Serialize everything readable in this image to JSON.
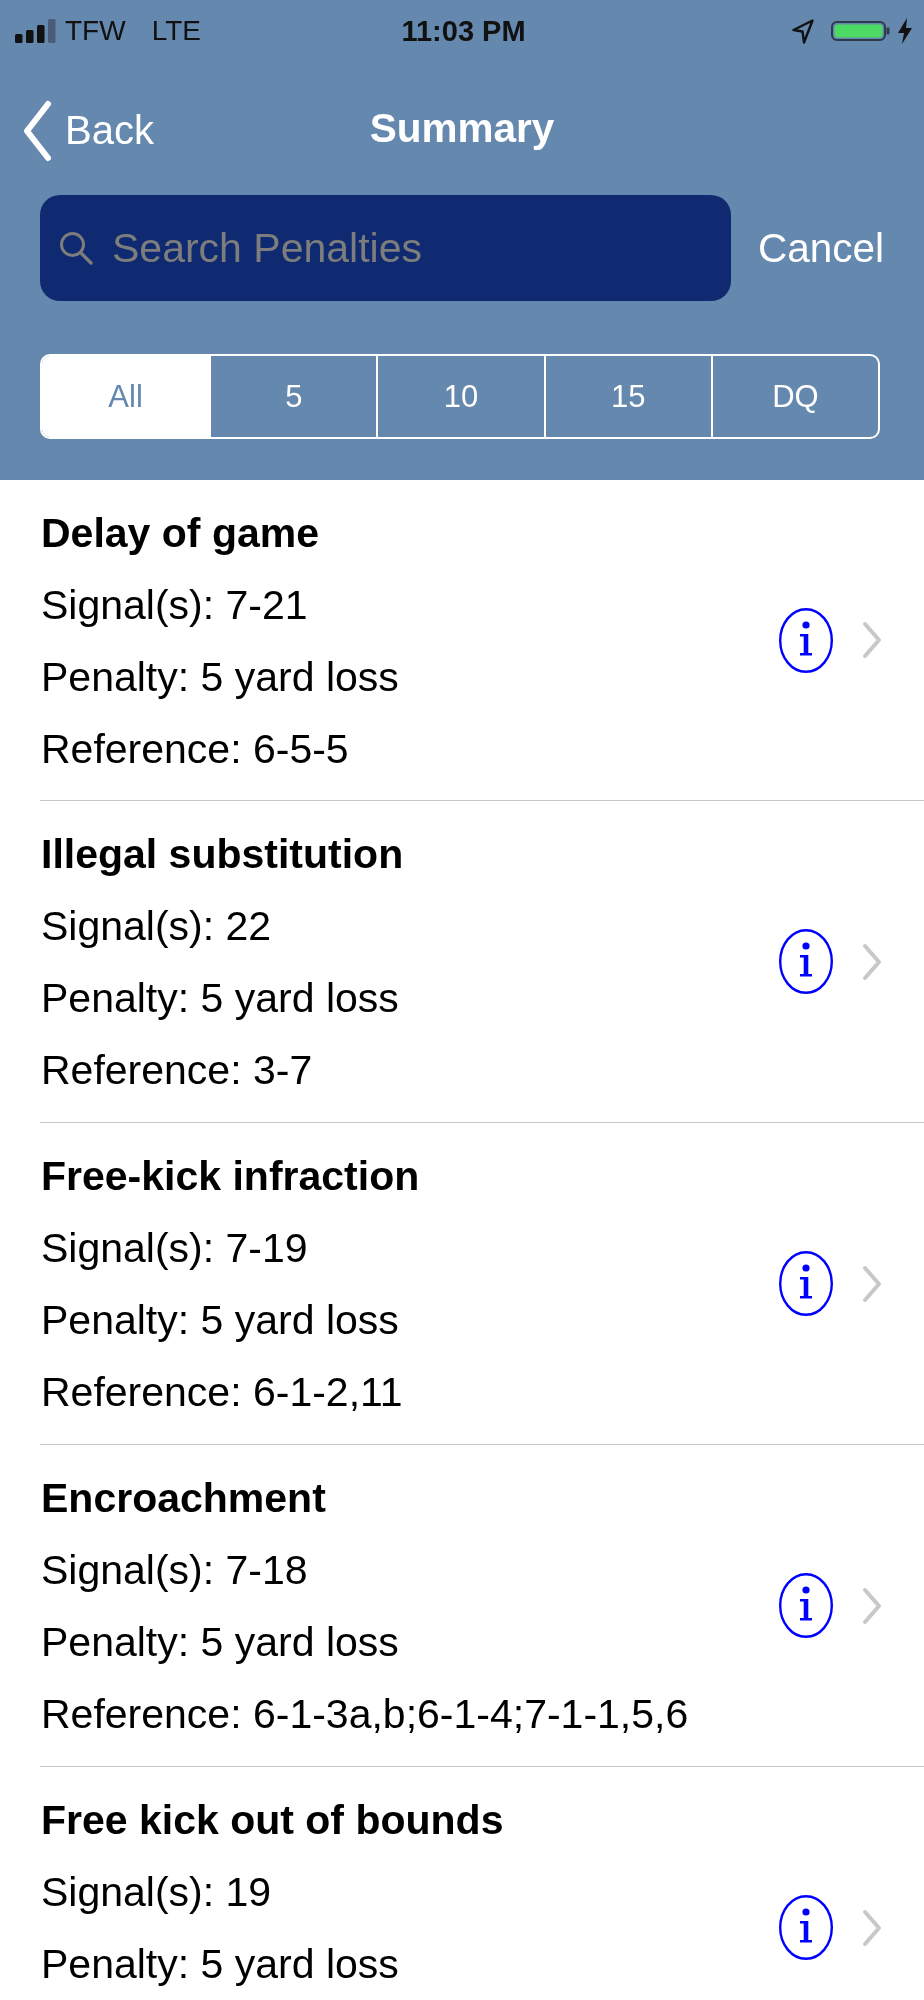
{
  "status_bar": {
    "carrier": "TFW",
    "network": "LTE",
    "time": "11:03 PM"
  },
  "nav": {
    "back": "Back",
    "title": "Summary"
  },
  "search": {
    "placeholder": "Search Penalties",
    "cancel": "Cancel"
  },
  "filters": [
    {
      "label": "All",
      "selected": true
    },
    {
      "label": "5",
      "selected": false
    },
    {
      "label": "10",
      "selected": false
    },
    {
      "label": "15",
      "selected": false
    },
    {
      "label": "DQ",
      "selected": false
    }
  ],
  "penalties": [
    {
      "name": "Delay of game",
      "signals": "Signal(s): 7-21",
      "penalty": "Penalty: 5 yard loss",
      "reference": "Reference: 6-5-5"
    },
    {
      "name": "Illegal substitution",
      "signals": "Signal(s): 22",
      "penalty": "Penalty: 5 yard loss",
      "reference": "Reference: 3-7"
    },
    {
      "name": "Free-kick infraction",
      "signals": "Signal(s): 7-19",
      "penalty": "Penalty: 5 yard loss",
      "reference": "Reference: 6-1-2,11"
    },
    {
      "name": "Encroachment",
      "signals": "Signal(s): 7-18",
      "penalty": "Penalty: 5 yard loss",
      "reference": "Reference: 6-1-3a,b;6-1-4;7-1-1,5,6"
    },
    {
      "name": "Free kick out of bounds",
      "signals": "Signal(s): 19",
      "penalty": "Penalty: 5 yard loss"
    }
  ]
}
